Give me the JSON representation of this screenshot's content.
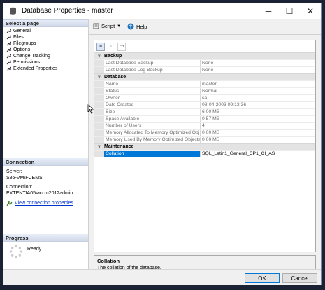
{
  "window": {
    "title": "Database Properties - master",
    "min_glyph": "─",
    "max_glyph": "☐",
    "close_glyph": "✕"
  },
  "left": {
    "select_page_header": "Select a page",
    "pages": [
      "General",
      "Files",
      "Filegroups",
      "Options",
      "Change Tracking",
      "Permissions",
      "Extended Properties"
    ],
    "connection_header": "Connection",
    "server_label": "Server:",
    "server_value": "S86-VM\\FCEMS",
    "connection_label": "Connection:",
    "connection_value": "EXTENTIA05\\accm2012admin",
    "view_link": "View connection properties",
    "progress_header": "Progress",
    "progress_status": "Ready"
  },
  "toolbar": {
    "script_label": "Script",
    "help_label": "Help"
  },
  "grid": {
    "categories": [
      {
        "name": "Backup",
        "rows": [
          {
            "name": "Last Database Backup",
            "value": "None"
          },
          {
            "name": "Last Database Log Backup",
            "value": "None"
          }
        ]
      },
      {
        "name": "Database",
        "rows": [
          {
            "name": "Name",
            "value": "master"
          },
          {
            "name": "Status",
            "value": "Normal"
          },
          {
            "name": "Owner",
            "value": "sa"
          },
          {
            "name": "Date Created",
            "value": "08-04-2003 09:13:36"
          },
          {
            "name": "Size",
            "value": "6.00 MB"
          },
          {
            "name": "Space Available",
            "value": "0.57 MB"
          },
          {
            "name": "Number of Users",
            "value": "4"
          },
          {
            "name": "Memory Allocated To Memory Optimized Obj",
            "value": "0.00 MB"
          },
          {
            "name": "Memory Used By Memory Optimized Objects",
            "value": "0.00 MB"
          }
        ]
      },
      {
        "name": "Maintenance",
        "rows": [
          {
            "name": "Collation",
            "value": "SQL_Latin1_General_CP1_CI_AS",
            "selected": true
          }
        ]
      }
    ]
  },
  "description": {
    "title": "Collation",
    "text": "The collation of the database."
  },
  "footer": {
    "ok_label": "OK",
    "cancel_label": "Cancel"
  },
  "colors": {
    "selection": "#0078d7",
    "link": "#0033cc"
  }
}
